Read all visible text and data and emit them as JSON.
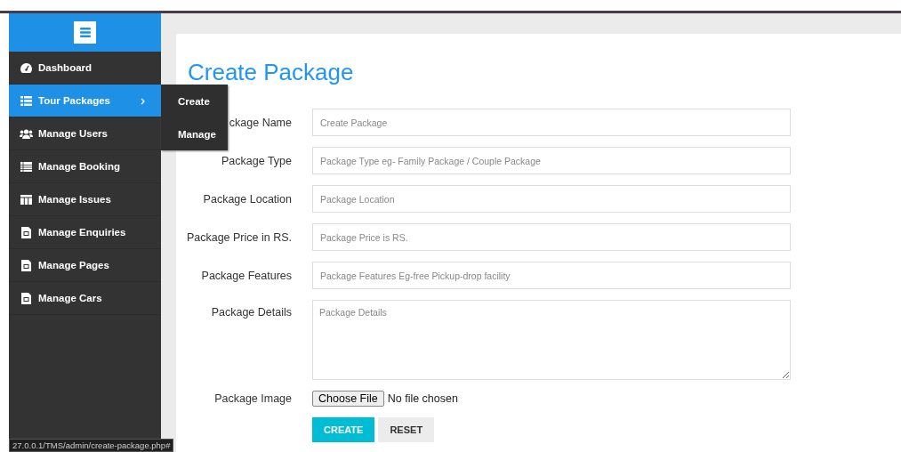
{
  "sidebar": {
    "items": [
      {
        "label": "Dashboard",
        "kind": "gauge",
        "selected": false
      },
      {
        "label": "Tour Packages",
        "kind": "list",
        "selected": true,
        "submenu": [
          {
            "label": "Create"
          },
          {
            "label": "Manage"
          }
        ]
      },
      {
        "label": "Manage Users",
        "kind": "users",
        "selected": false
      },
      {
        "label": "Manage Booking",
        "kind": "table",
        "selected": false
      },
      {
        "label": "Manage Issues",
        "kind": "columns",
        "selected": false
      },
      {
        "label": "Manage Enquiries",
        "kind": "file",
        "selected": false
      },
      {
        "label": "Manage Pages",
        "kind": "file",
        "selected": false
      },
      {
        "label": "Manage Cars",
        "kind": "file",
        "selected": false
      }
    ]
  },
  "form": {
    "title": "Create Package",
    "fields": [
      {
        "label": "ckage Name",
        "kind": "input",
        "placeholder": "Create Package"
      },
      {
        "label": "Package Type",
        "kind": "input",
        "placeholder": "Package Type eg- Family Package / Couple Package"
      },
      {
        "label": "Package Location",
        "kind": "input",
        "placeholder": "Package Location"
      },
      {
        "label": "Package Price in RS.",
        "kind": "input",
        "placeholder": "Package Price is RS."
      },
      {
        "label": "Package Features",
        "kind": "input",
        "placeholder": "Package Features Eg-free Pickup-drop facility"
      },
      {
        "label": "Package Details",
        "kind": "textarea",
        "placeholder": "Package Details"
      },
      {
        "label": "Package Image",
        "kind": "file",
        "button": "Choose File",
        "status": "No file chosen"
      }
    ],
    "buttons": [
      {
        "label": "CREATE",
        "kind": "primary"
      },
      {
        "label": "RESET",
        "kind": "default"
      }
    ]
  },
  "status_bar": {
    "url": "27.0.0.1/TMS/admin/create-package.php#"
  }
}
